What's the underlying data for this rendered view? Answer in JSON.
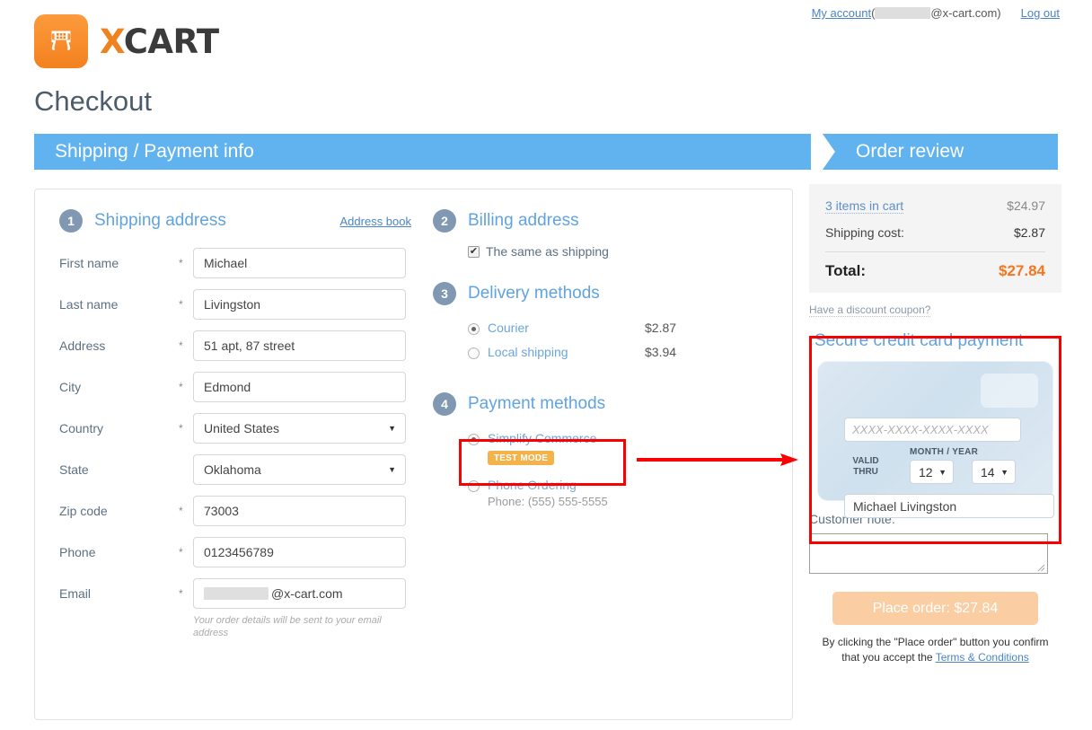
{
  "header": {
    "logo_text_x": "X",
    "logo_text_cart": "CART",
    "logo_icon": "shopping-cart-icon",
    "my_account_label": "My account",
    "account_open_paren": "(",
    "account_domain": "@x-cart.com)",
    "logout_label": "Log out"
  },
  "page_title": "Checkout",
  "tabs": [
    {
      "label": "Shipping / Payment info",
      "active": true
    },
    {
      "label": "Order review",
      "active": false
    }
  ],
  "shipping": {
    "step": "1",
    "title": "Shipping address",
    "address_book_label": "Address book",
    "required_mark": "*",
    "fields": [
      {
        "label": "First name",
        "value": "Michael",
        "required": true,
        "type": "text"
      },
      {
        "label": "Last name",
        "value": "Livingston",
        "required": true,
        "type": "text"
      },
      {
        "label": "Address",
        "value": "51 apt, 87 street",
        "required": true,
        "type": "text"
      },
      {
        "label": "City",
        "value": "Edmond",
        "required": true,
        "type": "text"
      },
      {
        "label": "Country",
        "value": "United States",
        "required": true,
        "type": "select"
      },
      {
        "label": "State",
        "value": "Oklahoma",
        "required": false,
        "type": "select"
      },
      {
        "label": "Zip code",
        "value": "73003",
        "required": true,
        "type": "text"
      },
      {
        "label": "Phone",
        "value": "0123456789",
        "required": true,
        "type": "text"
      }
    ],
    "email_label": "Email",
    "email_domain": "@x-cart.com",
    "email_hint": "Your order details will be sent to your email address"
  },
  "billing": {
    "step": "2",
    "title": "Billing address",
    "same_as_shipping_label": "The same as shipping",
    "same_as_shipping_checked": true,
    "check_glyph": "✔"
  },
  "delivery": {
    "step": "3",
    "title": "Delivery methods",
    "options": [
      {
        "label": "Courier",
        "price": "$2.87",
        "selected": true
      },
      {
        "label": "Local shipping",
        "price": "$3.94",
        "selected": false
      }
    ]
  },
  "payment": {
    "step": "4",
    "title": "Payment methods",
    "options": [
      {
        "label": "Simplify Commerce",
        "selected": true,
        "badge": "TEST MODE",
        "note": ""
      },
      {
        "label": "Phone Ordering",
        "selected": false,
        "badge": "",
        "note": "Phone: (555) 555-5555"
      }
    ]
  },
  "order_review": {
    "cart_link_label": "3 items in cart",
    "cart_value": "$24.97",
    "shipping_label": "Shipping cost:",
    "shipping_value": "$2.87",
    "total_label": "Total:",
    "total_value": "$27.84",
    "coupon_label": "Have a discount coupon?"
  },
  "credit_card": {
    "title": "Secure credit card payment",
    "number_placeholder": "XXXX-XXXX-XXXX-XXXX",
    "number_value": "",
    "month_year_label": "MONTH / YEAR",
    "valid_line1": "VALID",
    "valid_line2": "THRU",
    "month_value": "12",
    "year_value": "14",
    "cardholder_value": "Michael  Livingston",
    "caret_glyph": "▼"
  },
  "customer_note": {
    "label": "Customer note:",
    "value": ""
  },
  "footer": {
    "place_order_label": "Place order: $27.84",
    "terms_text_1": "By clicking the \"Place order\" button you confirm",
    "terms_text_2": "that you accept the ",
    "terms_link": "Terms & Conditions"
  },
  "colors": {
    "accent_blue": "#61b3ef",
    "heading_blue": "#61a3e0",
    "orange": "#f5761f",
    "highlight_red": "#fa0000",
    "badge_orange": "#f3b24a"
  }
}
